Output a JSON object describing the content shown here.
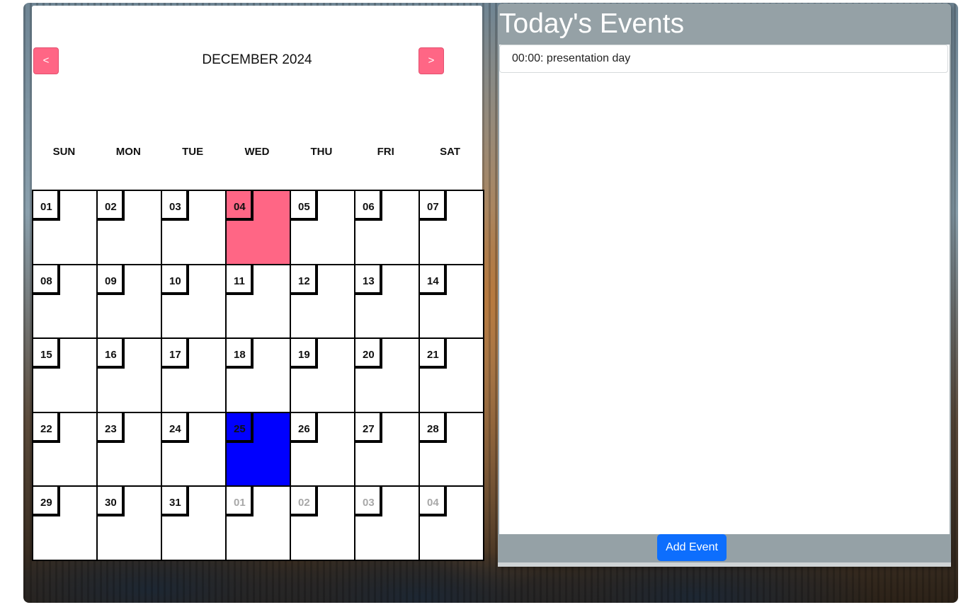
{
  "calendar": {
    "prev_label": "<",
    "next_label": ">",
    "month_label": "DECEMBER 2024",
    "weekdays": [
      "SUN",
      "MON",
      "TUE",
      "WED",
      "THU",
      "FRI",
      "SAT"
    ],
    "days": [
      {
        "label": "01",
        "state": "normal"
      },
      {
        "label": "02",
        "state": "normal"
      },
      {
        "label": "03",
        "state": "normal"
      },
      {
        "label": "04",
        "state": "selected"
      },
      {
        "label": "05",
        "state": "normal"
      },
      {
        "label": "06",
        "state": "normal"
      },
      {
        "label": "07",
        "state": "normal"
      },
      {
        "label": "08",
        "state": "normal"
      },
      {
        "label": "09",
        "state": "normal"
      },
      {
        "label": "10",
        "state": "normal"
      },
      {
        "label": "11",
        "state": "normal"
      },
      {
        "label": "12",
        "state": "normal"
      },
      {
        "label": "13",
        "state": "normal"
      },
      {
        "label": "14",
        "state": "normal"
      },
      {
        "label": "15",
        "state": "normal"
      },
      {
        "label": "16",
        "state": "normal"
      },
      {
        "label": "17",
        "state": "normal"
      },
      {
        "label": "18",
        "state": "normal"
      },
      {
        "label": "19",
        "state": "normal"
      },
      {
        "label": "20",
        "state": "normal"
      },
      {
        "label": "21",
        "state": "normal"
      },
      {
        "label": "22",
        "state": "normal"
      },
      {
        "label": "23",
        "state": "normal"
      },
      {
        "label": "24",
        "state": "normal"
      },
      {
        "label": "25",
        "state": "today"
      },
      {
        "label": "26",
        "state": "normal"
      },
      {
        "label": "27",
        "state": "normal"
      },
      {
        "label": "28",
        "state": "normal"
      },
      {
        "label": "29",
        "state": "normal"
      },
      {
        "label": "30",
        "state": "normal"
      },
      {
        "label": "31",
        "state": "normal"
      },
      {
        "label": "01",
        "state": "other"
      },
      {
        "label": "02",
        "state": "other"
      },
      {
        "label": "03",
        "state": "other"
      },
      {
        "label": "04",
        "state": "other"
      }
    ],
    "colors": {
      "selected": "#ff6685",
      "today": "#0000ff",
      "nav_button": "#ff6685",
      "other_month_text": "#a8a8a8"
    }
  },
  "events": {
    "title": "Today's Events",
    "items": [
      "00:00: presentation day"
    ],
    "add_button_label": "Add Event",
    "colors": {
      "panel": "#95a1a6",
      "add_button": "#0d6efd"
    }
  }
}
